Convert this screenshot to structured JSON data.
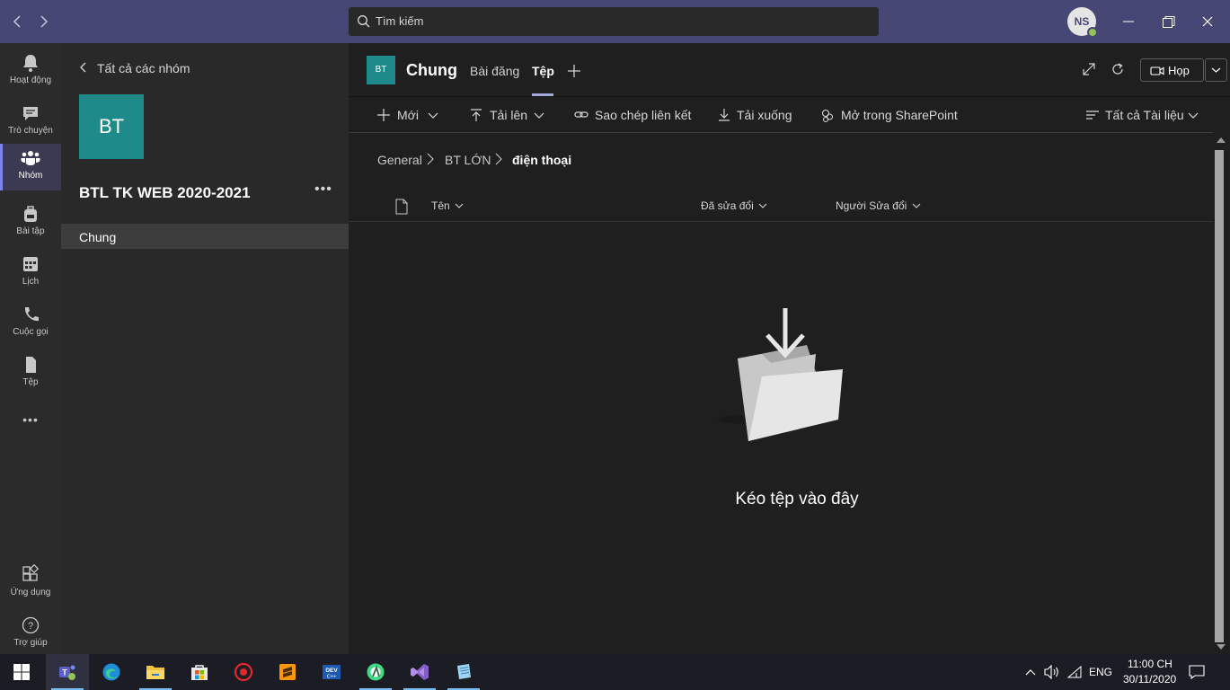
{
  "titlebar": {
    "search_placeholder": "Tìm kiếm",
    "avatar_initials": "NS"
  },
  "rail": {
    "items": [
      {
        "label": "Hoạt động",
        "icon": "bell-icon"
      },
      {
        "label": "Trò chuyện",
        "icon": "chat-icon"
      },
      {
        "label": "Nhóm",
        "icon": "teams-icon",
        "active": true
      },
      {
        "label": "Bài tập",
        "icon": "backpack-icon"
      },
      {
        "label": "Lịch",
        "icon": "calendar-icon"
      },
      {
        "label": "Cuộc gọi",
        "icon": "phone-icon"
      },
      {
        "label": "Tệp",
        "icon": "file-icon"
      }
    ],
    "more": "•••",
    "apps_label": "Ứng dụng",
    "help_label": "Trợ giúp"
  },
  "teampanel": {
    "back_label": "Tất cả các nhóm",
    "team_initials": "BT",
    "team_name": "BTL TK WEB 2020-2021",
    "more": "•••",
    "channel": "Chung"
  },
  "header": {
    "channel_initials": "BT",
    "channel_name": "Chung",
    "tabs": [
      "Bài đăng",
      "Tệp"
    ],
    "active_tab": "Tệp",
    "meet_label": "Họp"
  },
  "toolbar": {
    "new": "Mới",
    "upload": "Tải lên",
    "copy_link": "Sao chép liên kết",
    "download": "Tải xuống",
    "open_sharepoint": "Mở trong SharePoint",
    "view": "Tất cả Tài liệu"
  },
  "content": {
    "breadcrumb": [
      "General",
      "BT LỚN",
      "điện thoại"
    ],
    "columns": {
      "name": "Tên",
      "modified": "Đã sửa đổi",
      "modified_by": "Người Sửa đổi"
    },
    "empty_text": "Kéo tệp vào đây"
  },
  "taskbar": {
    "apps": [
      "windows-start",
      "teams",
      "edge",
      "file-explorer",
      "store",
      "antivirus",
      "sublime-text",
      "dev-cpp",
      "android-studio",
      "visual-studio",
      "notepad"
    ],
    "lang": "ENG",
    "time": "11:00 CH",
    "date": "30/11/2020"
  },
  "colors": {
    "titlebar": "#464775",
    "accent": "#7b83eb",
    "team_tile": "#1e8a8a",
    "presence_available": "#92c353"
  }
}
